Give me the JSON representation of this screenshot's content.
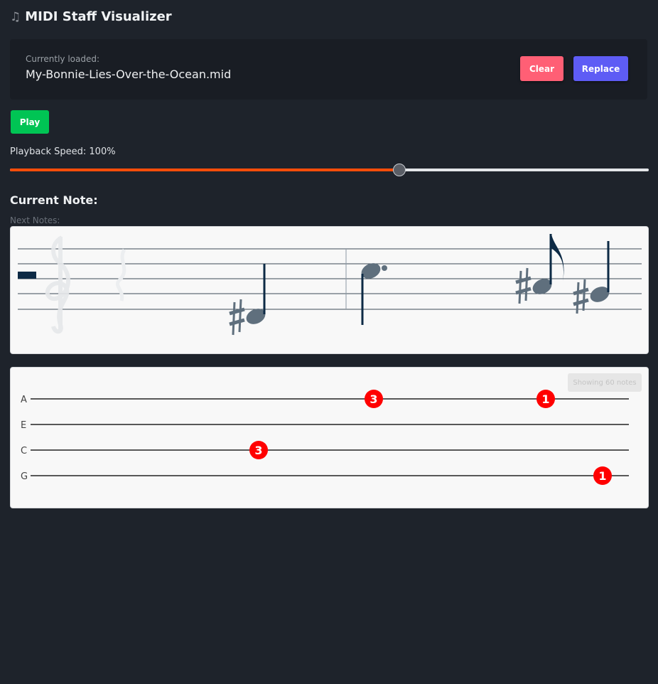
{
  "app": {
    "icon": "music-notes-icon",
    "title": "MIDI Staff Visualizer"
  },
  "file": {
    "caption": "Currently loaded:",
    "name": "My-Bonnie-Lies-Over-the-Ocean.mid",
    "clear_label": "Clear",
    "replace_label": "Replace"
  },
  "playback": {
    "play_label": "Play",
    "speed_label": "Playback Speed: 100%",
    "slider_fraction": 0.61,
    "colors": {
      "fill": "#ff4d0a",
      "play": "#00c454",
      "clear": "#ff5f75",
      "replace": "#5e5cf5"
    }
  },
  "current_note": {
    "label": "Current Note:"
  },
  "next_notes": {
    "label": "Next Notes:"
  },
  "tab": {
    "badge": "Showing 60 notes",
    "strings": [
      "A",
      "E",
      "C",
      "G"
    ],
    "fret_color": "#ff0000",
    "frets": [
      {
        "string": "A",
        "fret": "3"
      },
      {
        "string": "A",
        "fret": "1"
      },
      {
        "string": "C",
        "fret": "3"
      },
      {
        "string": "G",
        "fret": "1"
      }
    ]
  }
}
